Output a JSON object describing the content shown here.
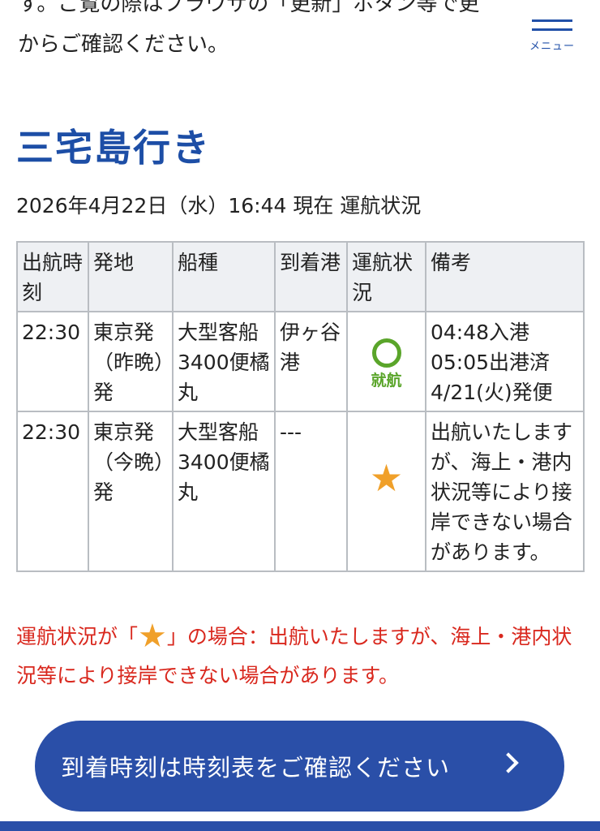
{
  "intro": {
    "line1": "す。ご覧の際はブラウザの「更新」ボタン等で更",
    "line2": "からご確認ください。"
  },
  "menu": {
    "label": "メニュー",
    "icon": "hamburger-icon"
  },
  "section": {
    "title": "三宅島行き",
    "status_line": "2026年4月22日（水）16:44 現在 運航状況"
  },
  "table": {
    "headers": [
      "出航時刻",
      "発地",
      "船種",
      "到着港",
      "運航状況",
      "備考"
    ],
    "rows": [
      {
        "time": "22:30",
        "origin": "東京発（昨晩）発",
        "ship": "大型客船3400便橘丸",
        "arrival": "伊ヶ谷港",
        "status_symbol": "",
        "status_label": "就航",
        "remarks": "04:48入港05:05出港済4/21(火)発便"
      },
      {
        "time": "22:30",
        "origin": "東京発（今晩）発",
        "ship": "大型客船3400便橘丸",
        "arrival": "---",
        "status_symbol": "★",
        "status_label": "",
        "remarks": "出航いたしますが、海上・港内状況等により接岸できない場合があります。"
      }
    ]
  },
  "note": {
    "prefix": "運航状況が「",
    "star": "★",
    "suffix": "」の場合：出航いたしますが、海上・港内状況等により接岸できない場合があります。"
  },
  "cta": {
    "label": "到着時刻は時刻表をご確認ください",
    "icon": "chevron-right-icon"
  },
  "colors": {
    "brand": "#2a4fa8",
    "title": "#1d4ea6",
    "ok": "#5aa52a",
    "star": "#f0a02a",
    "warning": "#d9281e"
  }
}
